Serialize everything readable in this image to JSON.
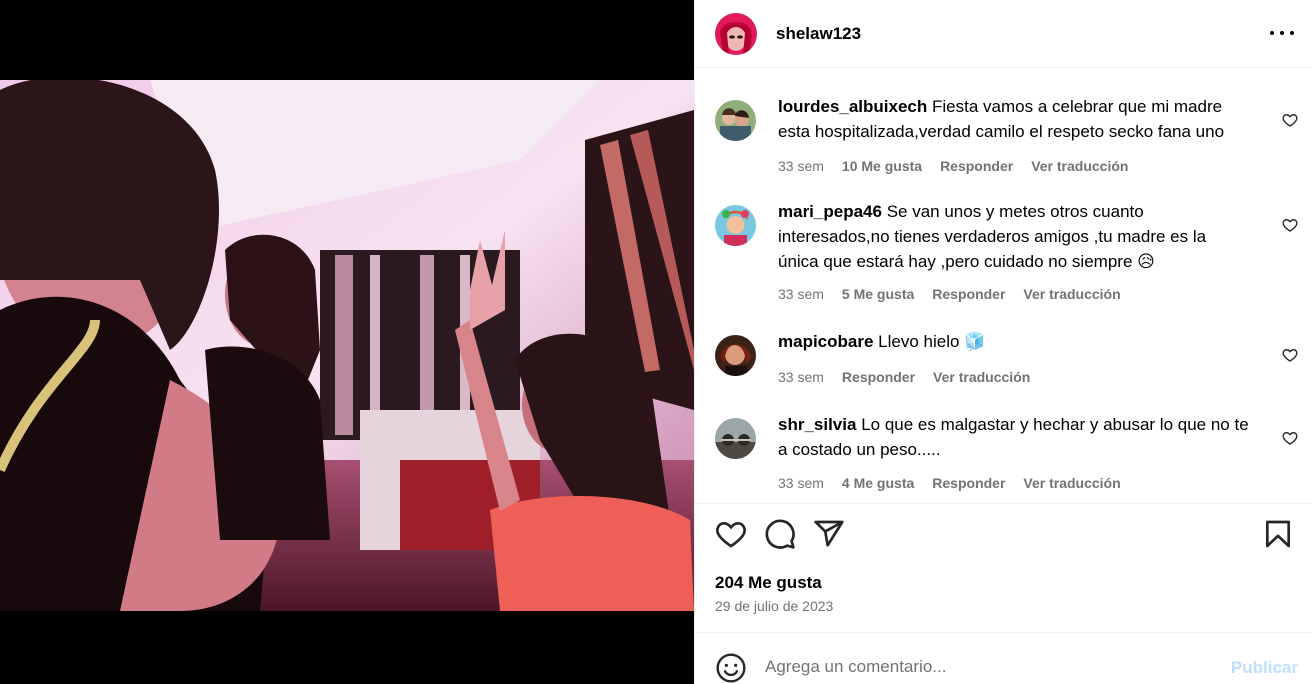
{
  "post": {
    "author": "shelaw123",
    "likes_total": "204 Me gusta",
    "date": "29 de julio de 2023"
  },
  "comments": [
    {
      "user": "lourdes_albuixech",
      "text": "Fiesta vamos a celebrar que mi madre esta hospitalizada,verdad camilo el respeto secko fana uno",
      "time": "33 sem",
      "likes": "10 Me gusta",
      "reply": "Responder",
      "translate": "Ver traducción"
    },
    {
      "user": "mari_pepa46",
      "text": "Se van unos y metes otros cuanto interesados,no tienes verdaderos amigos ,tu madre es la única que estará hay ,pero cuidado no siempre 😥",
      "time": "33 sem",
      "likes": "5 Me gusta",
      "reply": "Responder",
      "translate": "Ver traducción"
    },
    {
      "user": "mapicobare",
      "text": "Llevo hielo 🧊",
      "time": "33 sem",
      "reply": "Responder",
      "translate": "Ver traducción"
    },
    {
      "user": "shr_silvia",
      "text": "Lo que es malgastar y hechar y abusar lo que no te a costado un peso.....",
      "time": "33 sem",
      "likes": "4 Me gusta",
      "reply": "Responder",
      "translate": "Ver traducción"
    }
  ],
  "composer": {
    "placeholder": "Agrega un comentario...",
    "publish_label": "Publicar"
  },
  "icons": {
    "like": "heart-icon",
    "comment": "comment-icon",
    "share": "share-icon",
    "save": "bookmark-icon",
    "more": "more-options-icon",
    "emoji": "emoji-icon"
  },
  "colors": {
    "muted": "#737373",
    "publish_disabled": "#c2e0fd",
    "divider": "#efefef"
  }
}
